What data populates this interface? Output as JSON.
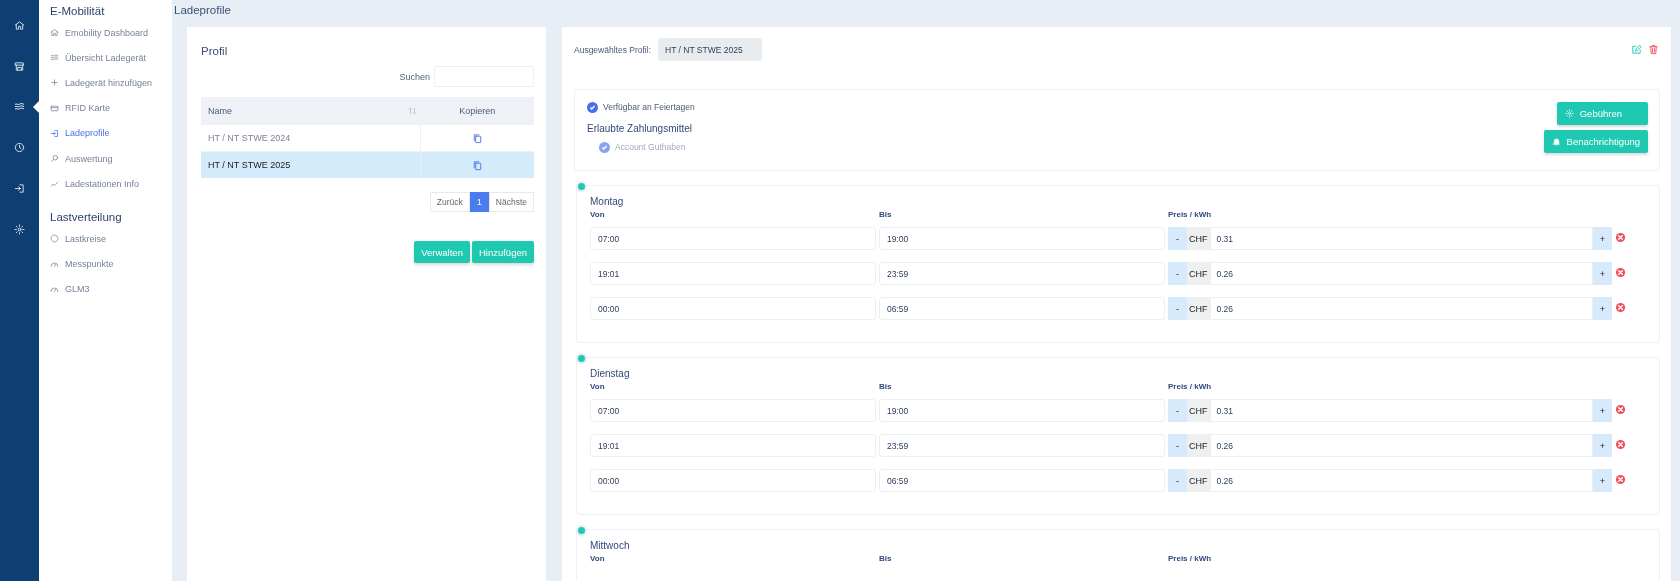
{
  "rail": {
    "items": [
      {
        "kind": "home",
        "selected": false
      },
      {
        "kind": "store",
        "selected": false
      },
      {
        "kind": "waves",
        "selected": true
      },
      {
        "kind": "clock",
        "selected": false
      },
      {
        "kind": "login",
        "selected": false
      },
      {
        "kind": "gear",
        "selected": false
      }
    ]
  },
  "sidebar": {
    "sections": [
      {
        "title": "E-Mobilität",
        "items": [
          {
            "label": "Emobility Dashboard",
            "kind": "home",
            "selected": false
          },
          {
            "label": "Übersicht Ladegerät",
            "kind": "waves",
            "selected": false
          },
          {
            "label": "Ladegerät hinzufügen",
            "kind": "plus",
            "selected": false
          },
          {
            "label": "RFID Karte",
            "kind": "card",
            "selected": false
          },
          {
            "label": "Ladeprofile",
            "kind": "login",
            "selected": true
          },
          {
            "label": "Auswertung",
            "kind": "search",
            "selected": false
          },
          {
            "label": "Ladestationen Info",
            "kind": "chart",
            "selected": false
          }
        ]
      },
      {
        "title": "Lastverteilung",
        "items": [
          {
            "label": "Lastkreise",
            "kind": "circle",
            "selected": false
          },
          {
            "label": "Messpunkte",
            "kind": "gauge",
            "selected": false
          },
          {
            "label": "GLM3",
            "kind": "gauge",
            "selected": false
          }
        ]
      }
    ]
  },
  "page_title": "Ladeprofile",
  "profile_panel": {
    "title": "Profil",
    "search": {
      "label": "Suchen"
    },
    "table": {
      "columns": [
        "Name",
        "Kopieren"
      ],
      "rows": [
        {
          "name": "HT / NT STWE 2024",
          "selected": false
        },
        {
          "name": "HT / NT STWE 2025",
          "selected": true
        }
      ]
    },
    "pagination": {
      "previous": "Zurück",
      "pages": [
        {
          "label": "1",
          "selected": true
        }
      ],
      "next": "Nächste"
    },
    "buttons": [
      "Verwalten",
      "Hinzufügen"
    ]
  },
  "detail": {
    "selected_profile": {
      "label": "Ausgewähltes Profil:",
      "value": "HT / NT STWE 2025"
    },
    "holiday": {
      "label": "Verfügbar an Feiertagen",
      "checked": true
    },
    "payment_title": "Erlaubte Zahlungsmittel",
    "payment_methods": [
      {
        "label": "Account Guthaben",
        "checked": true,
        "disabled": true
      }
    ],
    "buttons": [
      {
        "label": "Gebühren",
        "kind": "gear"
      },
      {
        "label": "Benachrichtigung",
        "kind": "bell"
      }
    ],
    "days": [
      {
        "name": "Montag",
        "columns": [
          "Von",
          "Bis",
          "Preis / kWh"
        ],
        "rows": [
          {
            "from": "07:00",
            "to": "19:00",
            "minus": "-",
            "currency": "CHF",
            "price": "0.31",
            "plus": "+"
          },
          {
            "from": "19:01",
            "to": "23:59",
            "minus": "-",
            "currency": "CHF",
            "price": "0.26",
            "plus": "+"
          },
          {
            "from": "00:00",
            "to": "06:59",
            "minus": "-",
            "currency": "CHF",
            "price": "0.26",
            "plus": "+"
          }
        ]
      },
      {
        "name": "Dienstag",
        "columns": [
          "Von",
          "Bis",
          "Preis / kWh"
        ],
        "rows": [
          {
            "from": "07:00",
            "to": "19:00",
            "minus": "-",
            "currency": "CHF",
            "price": "0.31",
            "plus": "+"
          },
          {
            "from": "19:01",
            "to": "23:59",
            "minus": "-",
            "currency": "CHF",
            "price": "0.26",
            "plus": "+"
          },
          {
            "from": "00:00",
            "to": "06:59",
            "minus": "-",
            "currency": "CHF",
            "price": "0.26",
            "plus": "+"
          }
        ]
      },
      {
        "name": "Mittwoch",
        "columns": [
          "Von",
          "Bis",
          "Preis / kWh"
        ]
      }
    ]
  }
}
